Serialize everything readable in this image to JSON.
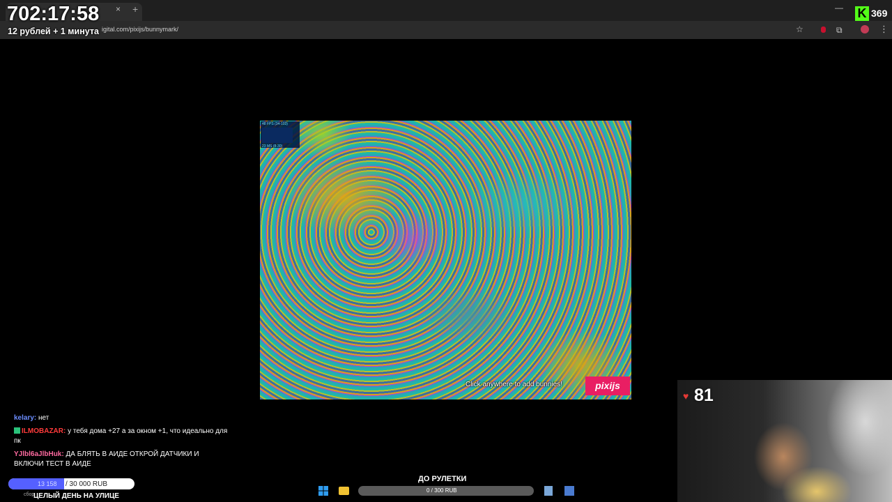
{
  "browser": {
    "url": "igital.com/pixijs/bunnymark/",
    "tab_close": "×",
    "new_tab": "+",
    "minimize": "—",
    "star": "☆",
    "menu": "⋮"
  },
  "overlay": {
    "timer": "702:17:58",
    "price": "12 рублей + 1 минута",
    "viewers_logo": "K",
    "viewers": "369",
    "heart_count": "81"
  },
  "canvas": {
    "fps_label": "48 FPS (34-103)",
    "ms_label": "23 MS (8-30)",
    "hint": "Click anywhere to add bunnies!",
    "logo": "pixijs"
  },
  "chat": [
    {
      "user": "kelary:",
      "message": "нет",
      "user_color": "#6b8dff"
    },
    {
      "user": "ILMOBAZAR:",
      "message": "у тебя дома +27 а за окном +1, что идеально для пк",
      "user_color": "#ff3b3b"
    },
    {
      "user": "YJlbl6aJlbHuk:",
      "message": "ДА БЛЯТЬ В АИДЕ ОТКРОЙ ДАТЧИКИ И ВКЛЮЧИ ТЕСТ В АИДЕ",
      "user_color": "#ff6aa0"
    }
  ],
  "goal": {
    "current": "13 158",
    "total": "/ 30 000 RUB",
    "title": "ЦЕЛЫЙ ДЕНЬ НА УЛИЦЕ",
    "prefix": "сбор",
    "progress": 0.44
  },
  "roulette": {
    "title": "ДО РУЛЕТКИ",
    "text": "0 / 300 RUB"
  },
  "colors": {
    "kick_green": "#53fc18",
    "goal_fill": "#5560ff",
    "pixi_pink": "#e91e63"
  }
}
